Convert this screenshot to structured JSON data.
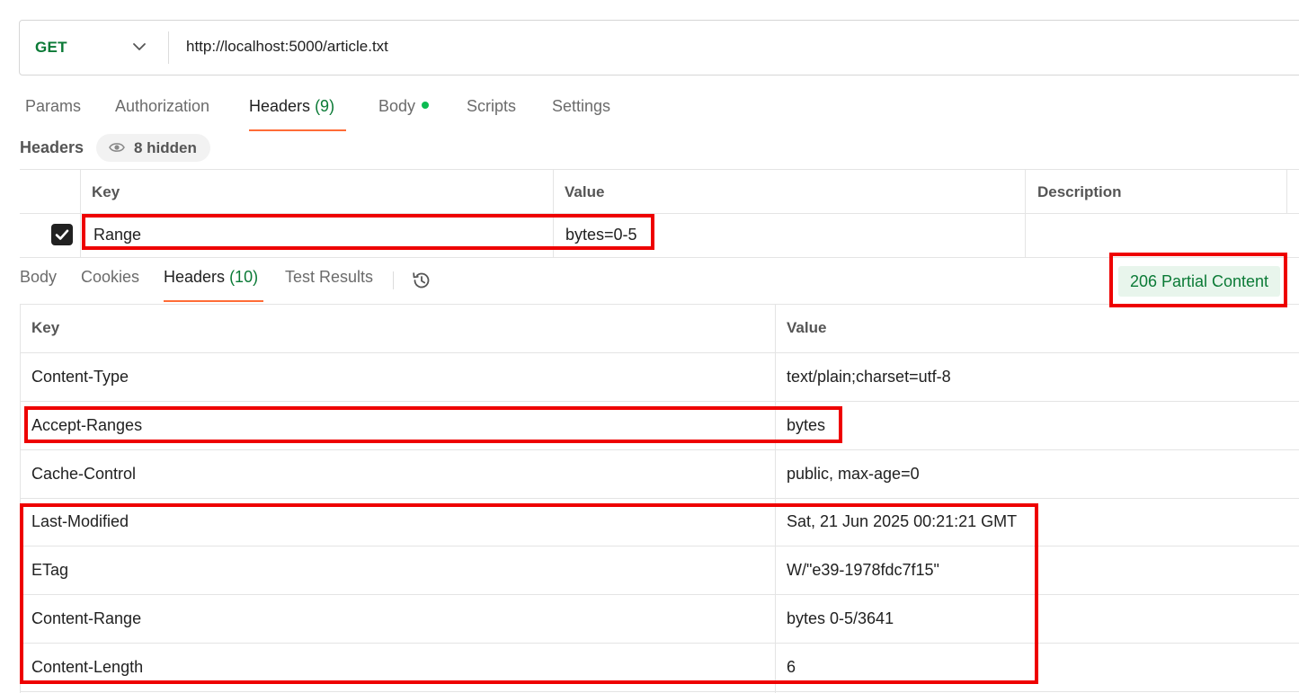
{
  "request": {
    "method": "GET",
    "url": "http://localhost:5000/article.txt",
    "tabs": [
      {
        "label": "Params"
      },
      {
        "label": "Authorization"
      },
      {
        "label": "Headers",
        "count": "(9)"
      },
      {
        "label": "Body"
      },
      {
        "label": "Scripts"
      },
      {
        "label": "Settings"
      }
    ],
    "headers_title": "Headers",
    "hidden_label": "8 hidden",
    "table": {
      "columns": [
        "Key",
        "Value",
        "Description"
      ],
      "rows": [
        {
          "key": "Range",
          "value": "bytes=0-5",
          "description": ""
        }
      ]
    }
  },
  "response": {
    "tabs": [
      {
        "label": "Body"
      },
      {
        "label": "Cookies"
      },
      {
        "label": "Headers",
        "count": "(10)"
      },
      {
        "label": "Test Results"
      }
    ],
    "status": "206 Partial Content",
    "table": {
      "columns": [
        "Key",
        "Value"
      ],
      "rows": [
        {
          "key": "Content-Type",
          "value": "text/plain;charset=utf-8"
        },
        {
          "key": "Accept-Ranges",
          "value": "bytes"
        },
        {
          "key": "Cache-Control",
          "value": "public, max-age=0"
        },
        {
          "key": "Last-Modified",
          "value": "Sat, 21 Jun 2025 00:21:21 GMT"
        },
        {
          "key": "ETag",
          "value": "W/\"e39-1978fdc7f15\""
        },
        {
          "key": "Content-Range",
          "value": "bytes 0-5/3641"
        },
        {
          "key": "Content-Length",
          "value": "6"
        }
      ]
    }
  },
  "colors": {
    "accent_tab_underline": "#ff6c37",
    "method_green": "#0b7a36",
    "status_bg": "#e8f5ec",
    "highlight_red": "#ee0000"
  },
  "icons": [
    "chevron-down-icon",
    "eye-icon",
    "checkbox-checked-icon",
    "history-icon",
    "status-dot-icon"
  ]
}
